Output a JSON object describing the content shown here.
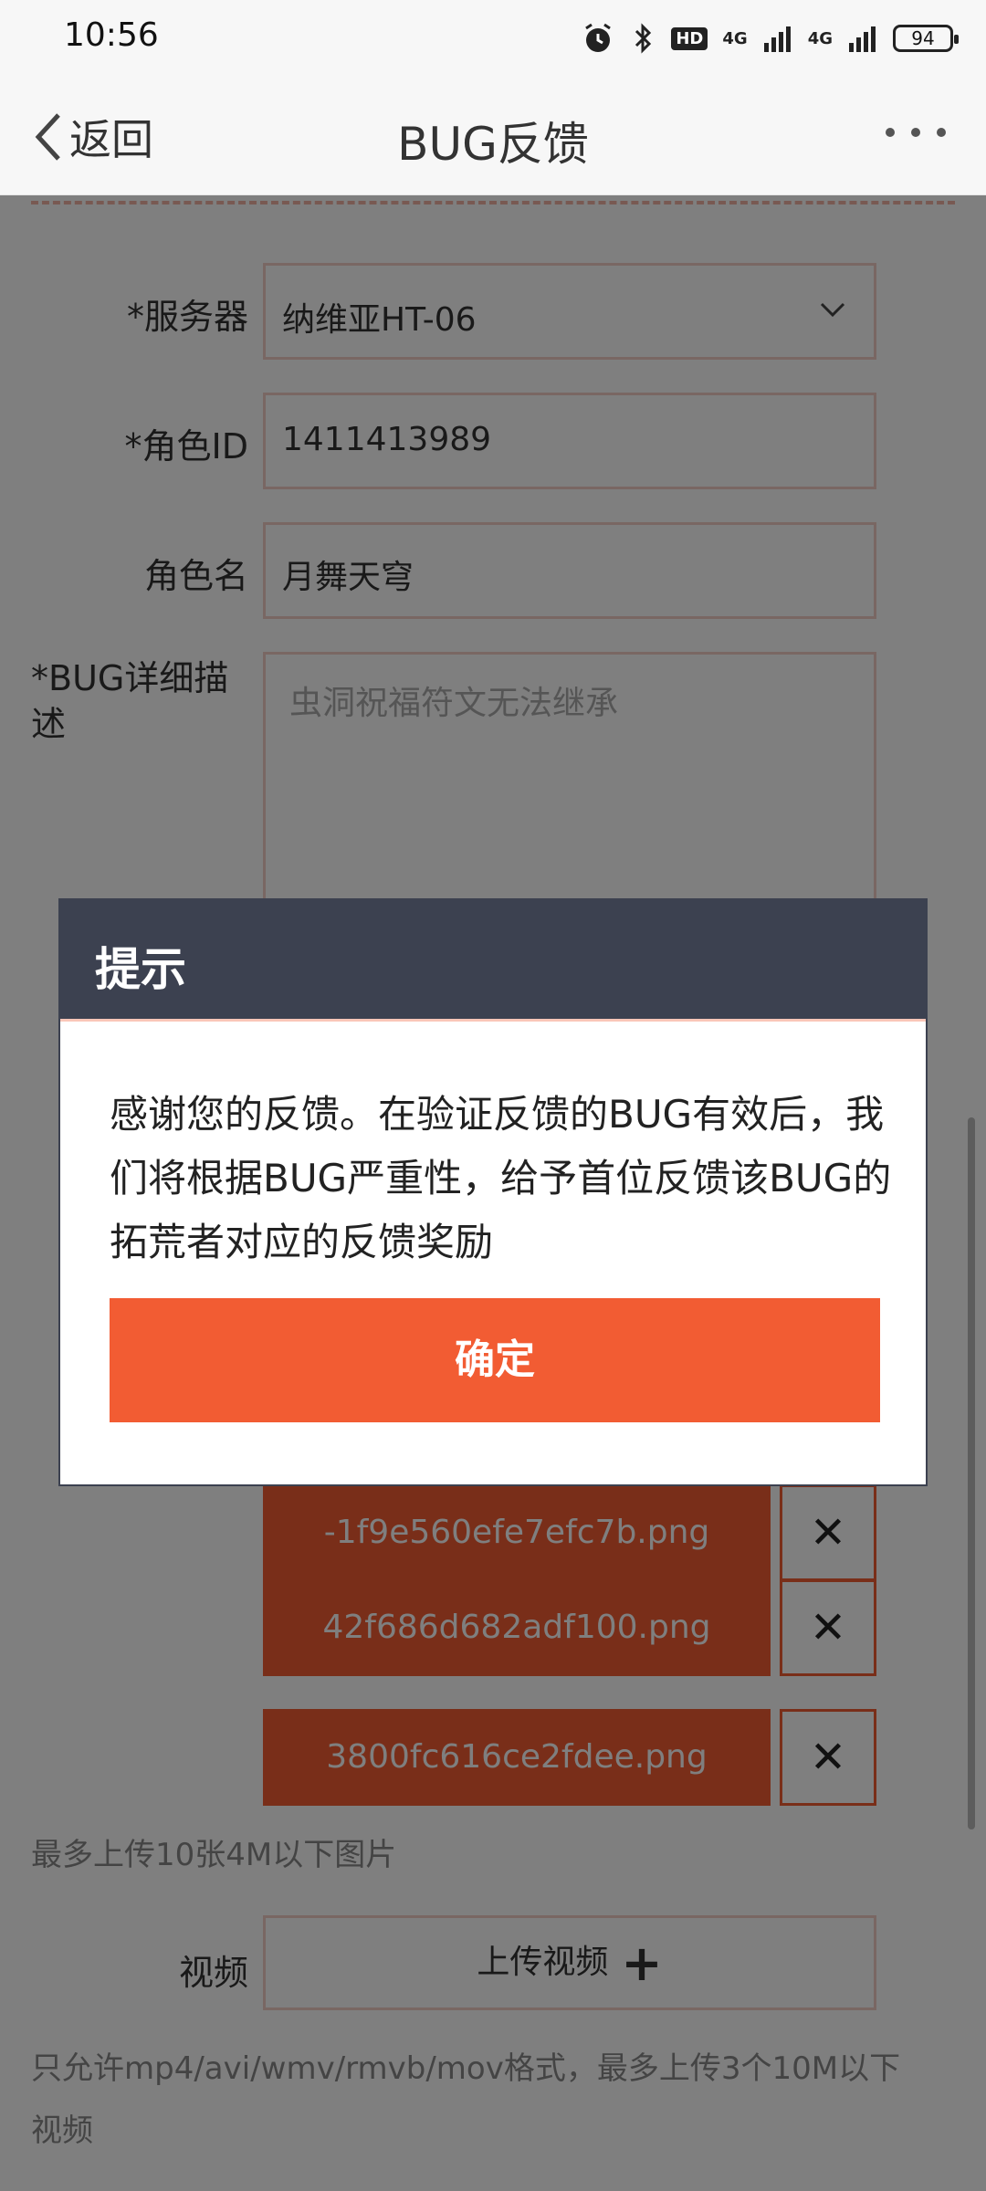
{
  "status_bar": {
    "time": "10:56",
    "battery": "94",
    "network": "4G"
  },
  "nav": {
    "back_label": "返回",
    "title": "BUG反馈"
  },
  "form": {
    "server_label": "*服务器",
    "server_value": "纳维亚HT-06",
    "role_id_label": "*角色ID",
    "role_id_value": "1411413989",
    "role_name_label": "角色名",
    "role_name_value": "月舞天穹",
    "desc_label": "*BUG详细描述",
    "desc_value": "虫洞祝福符文无法继承",
    "files": [
      "-1f9e560efe7efc7b.png",
      "42f686d682adf100.png",
      "3800fc616ce2fdee.png"
    ],
    "image_note": "最多上传10张4M以下图片",
    "video_label": "视频",
    "upload_video_label": "上传视频",
    "video_note": "只允许mp4/avi/wmv/rmvb/mov格式，最多上传3个10M以下视频"
  },
  "dialog": {
    "title": "提示",
    "message": "感谢您的反馈。在验证反馈的BUG有效后，我们将根据BUG严重性，给予首位反馈该BUG的拓荒者对应的反馈奖励",
    "confirm_label": "确定"
  },
  "colors": {
    "accent": "#f25c33",
    "dialog_header": "#3c4150",
    "field_border": "#f3cfc6"
  }
}
